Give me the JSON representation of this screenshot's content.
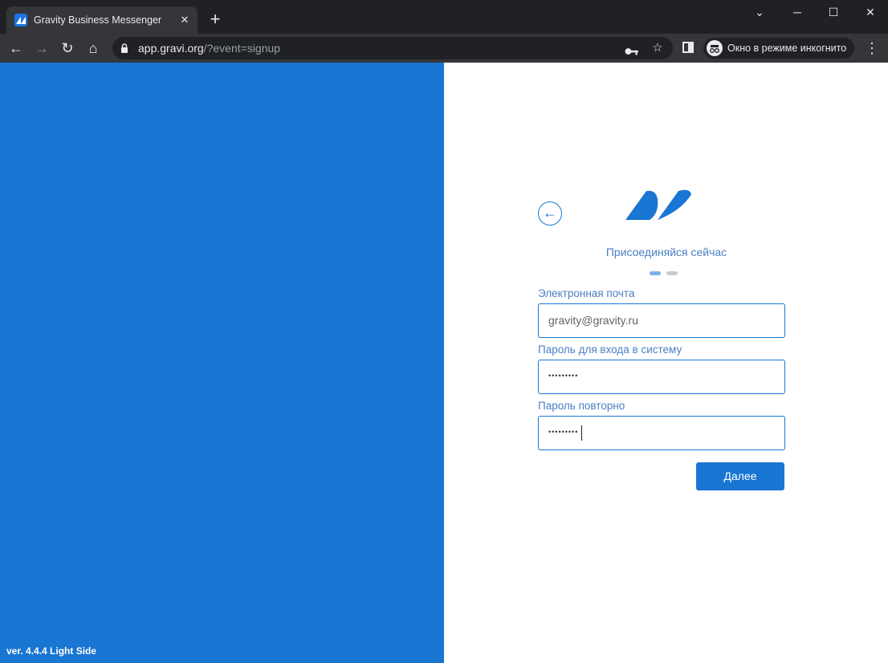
{
  "browser": {
    "tab": {
      "title": "Gravity Business Messenger",
      "close": "✕"
    },
    "new_tab": "+",
    "window_controls": {
      "tab_search": "⌄",
      "minimize": "─",
      "maximize": "☐",
      "close": "✕"
    },
    "nav": {
      "back": "←",
      "forward": "→",
      "reload": "↻",
      "home": "⌂"
    },
    "url": {
      "domain": "app.gravi.org",
      "rest": "/?event=signup"
    },
    "omnibox_icons": {
      "key": "key-icon",
      "bookmark": "☆"
    },
    "incognito_label": "Окно в режиме инкогнито",
    "menu": "⋮"
  },
  "left": {
    "version": "ver. 4.4.4 Light Side"
  },
  "signup": {
    "back": "←",
    "title": "Присоединяйся сейчас",
    "steps": {
      "current": 1,
      "total": 2
    },
    "email": {
      "label": "Электронная почта",
      "value": "gravity@gravity.ru"
    },
    "password": {
      "label": "Пароль для входа в систему",
      "value": "•••••••••"
    },
    "password_repeat": {
      "label": "Пароль повторно",
      "value": "•••••••••"
    },
    "next_label": "Далее"
  },
  "colors": {
    "brand": "#1976d2",
    "chrome_dark": "#202124",
    "chrome_toolbar": "#35363a"
  }
}
